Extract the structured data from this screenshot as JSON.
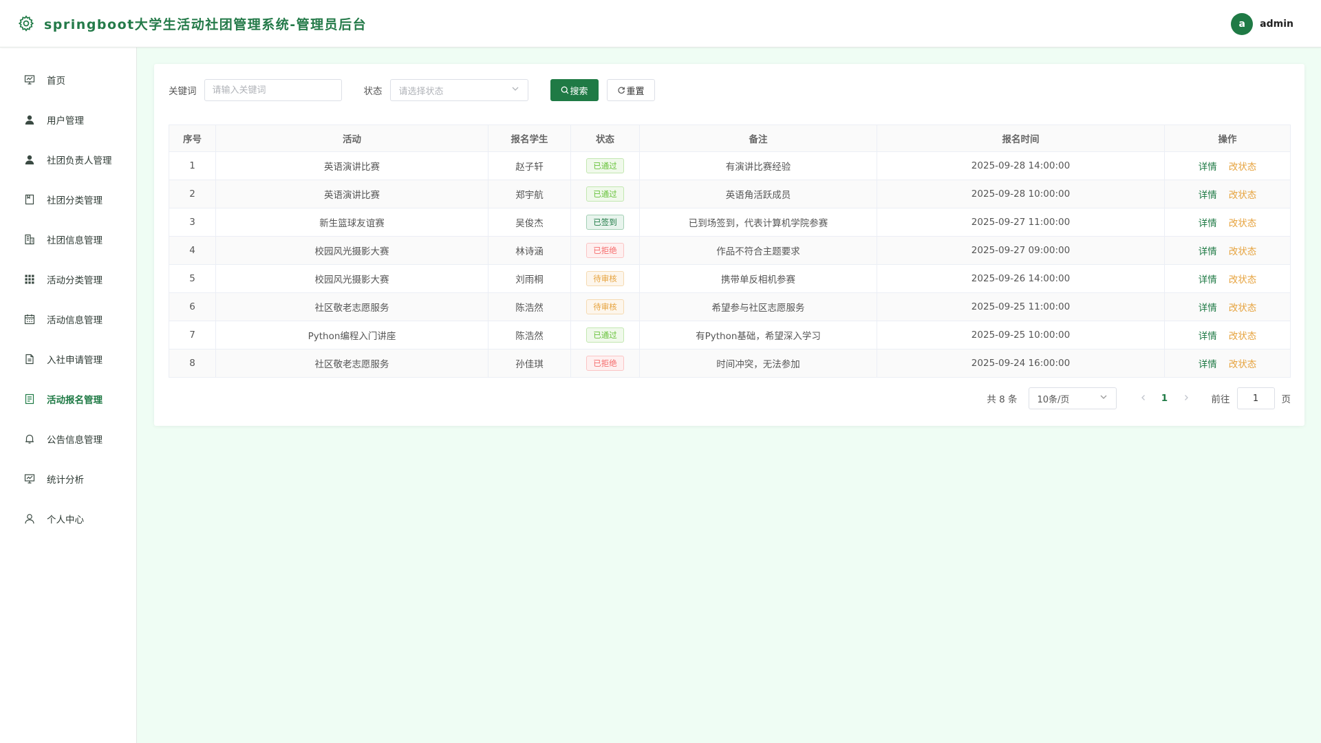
{
  "header": {
    "title": "springboot大学生活动社团管理系统-管理员后台",
    "avatar_letter": "a",
    "username": "admin"
  },
  "sidebar": {
    "items": [
      {
        "label": "首页",
        "icon": "chart-board-icon",
        "active": false
      },
      {
        "label": "用户管理",
        "icon": "user-filled-icon",
        "active": false
      },
      {
        "label": "社团负责人管理",
        "icon": "user-filled-icon",
        "active": false
      },
      {
        "label": "社团分类管理",
        "icon": "notebook-icon",
        "active": false
      },
      {
        "label": "社团信息管理",
        "icon": "office-building-icon",
        "active": false
      },
      {
        "label": "活动分类管理",
        "icon": "grid-icon",
        "active": false
      },
      {
        "label": "活动信息管理",
        "icon": "calendar-icon",
        "active": false
      },
      {
        "label": "入社申请管理",
        "icon": "document-icon",
        "active": false
      },
      {
        "label": "活动报名管理",
        "icon": "tickets-icon",
        "active": true
      },
      {
        "label": "公告信息管理",
        "icon": "bell-icon",
        "active": false
      },
      {
        "label": "统计分析",
        "icon": "chart-board-icon",
        "active": false
      },
      {
        "label": "个人中心",
        "icon": "user-outline-icon",
        "active": false
      }
    ]
  },
  "search": {
    "keyword_label": "关键词",
    "keyword_value": "",
    "keyword_placeholder": "请输入关键词",
    "status_label": "状态",
    "status_placeholder": "请选择状态",
    "search_button": "搜索",
    "reset_button": "重置"
  },
  "table": {
    "columns": [
      "序号",
      "活动",
      "报名学生",
      "状态",
      "备注",
      "报名时间",
      "操作"
    ],
    "detail_label": "详情",
    "change_status_label": "改状态",
    "rows": [
      {
        "index": "1",
        "activity": "英语演讲比赛",
        "student": "赵子轩",
        "status": "已通过",
        "status_type": "pass",
        "remark": "有演讲比赛经验",
        "time": "2025-09-28 14:00:00"
      },
      {
        "index": "2",
        "activity": "英语演讲比赛",
        "student": "郑宇航",
        "status": "已通过",
        "status_type": "pass",
        "remark": "英语角活跃成员",
        "time": "2025-09-28 10:00:00"
      },
      {
        "index": "3",
        "activity": "新生篮球友谊赛",
        "student": "吴俊杰",
        "status": "已签到",
        "status_type": "sign",
        "remark": "已到场签到，代表计算机学院参赛",
        "time": "2025-09-27 11:00:00"
      },
      {
        "index": "4",
        "activity": "校园风光摄影大赛",
        "student": "林诗涵",
        "status": "已拒绝",
        "status_type": "reject",
        "remark": "作品不符合主题要求",
        "time": "2025-09-27 09:00:00"
      },
      {
        "index": "5",
        "activity": "校园风光摄影大赛",
        "student": "刘雨桐",
        "status": "待审核",
        "status_type": "wait",
        "remark": "携带单反相机参赛",
        "time": "2025-09-26 14:00:00"
      },
      {
        "index": "6",
        "activity": "社区敬老志愿服务",
        "student": "陈浩然",
        "status": "待审核",
        "status_type": "wait",
        "remark": "希望参与社区志愿服务",
        "time": "2025-09-25 11:00:00"
      },
      {
        "index": "7",
        "activity": "Python编程入门讲座",
        "student": "陈浩然",
        "status": "已通过",
        "status_type": "pass",
        "remark": "有Python基础，希望深入学习",
        "time": "2025-09-25 10:00:00"
      },
      {
        "index": "8",
        "activity": "社区敬老志愿服务",
        "student": "孙佳琪",
        "status": "已拒绝",
        "status_type": "reject",
        "remark": "时间冲突，无法参加",
        "time": "2025-09-24 16:00:00"
      }
    ]
  },
  "pagination": {
    "total_text": "共 8 条",
    "page_size": "10条/页",
    "current_page": "1",
    "goto_label": "前往",
    "goto_value": "1",
    "page_suffix": "页"
  },
  "colors": {
    "primary": "#1f7a45",
    "background": "#effdf4",
    "warning": "#e6a23c",
    "success": "#67c23a",
    "danger": "#f56c6c"
  }
}
